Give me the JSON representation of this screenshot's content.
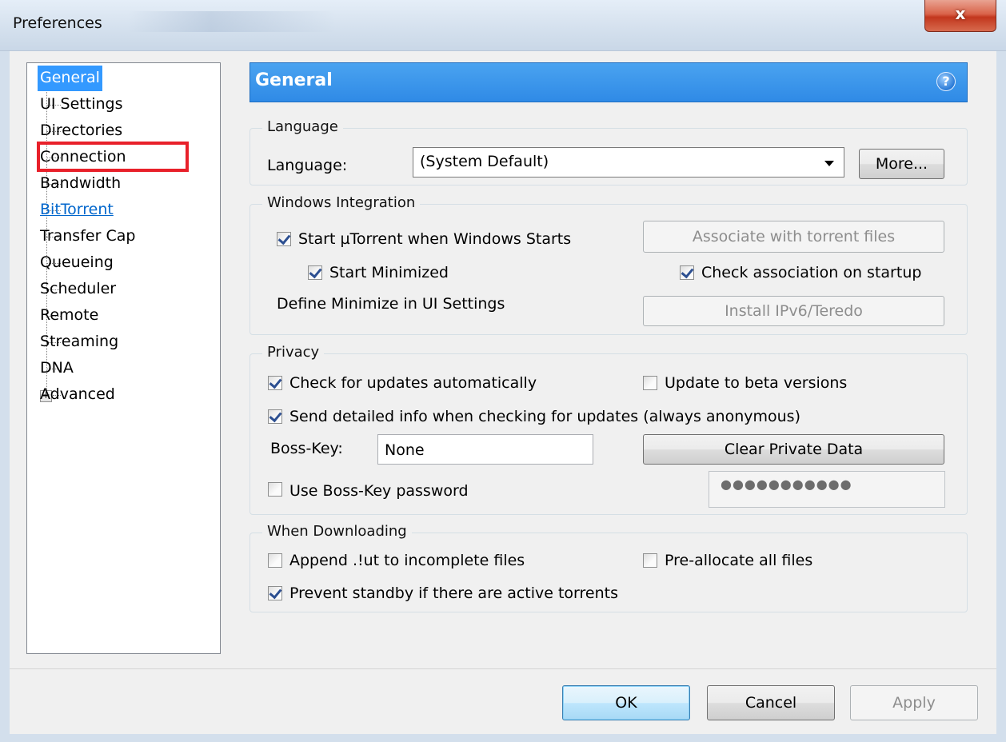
{
  "window": {
    "title": "Preferences",
    "close_glyph": "x"
  },
  "tree": {
    "items": [
      {
        "label": "General",
        "state": "selected"
      },
      {
        "label": "UI Settings"
      },
      {
        "label": "Directories"
      },
      {
        "label": "Connection"
      },
      {
        "label": "Bandwidth"
      },
      {
        "label": "BitTorrent",
        "state": "link"
      },
      {
        "label": "Transfer Cap"
      },
      {
        "label": "Queueing"
      },
      {
        "label": "Scheduler"
      },
      {
        "label": "Remote"
      },
      {
        "label": "Streaming"
      },
      {
        "label": "DNA"
      },
      {
        "label": "Advanced",
        "expandable": true
      }
    ],
    "expander_glyph": "+"
  },
  "header": {
    "title": "General",
    "help_glyph": "?"
  },
  "language": {
    "group_title": "Language",
    "label": "Language:",
    "selected": "(System Default)",
    "more_button": "More..."
  },
  "windows_integration": {
    "group_title": "Windows Integration",
    "start_with_windows": {
      "label": "Start µTorrent when Windows Starts",
      "checked": true
    },
    "start_minimized": {
      "label": "Start Minimized",
      "checked": true
    },
    "define_minimize": "Define Minimize in UI Settings",
    "associate_button": "Associate with torrent files",
    "check_association": {
      "label": "Check association on startup",
      "checked": true
    },
    "install_ipv6_button": "Install IPv6/Teredo"
  },
  "privacy": {
    "group_title": "Privacy",
    "check_updates": {
      "label": "Check for updates automatically",
      "checked": true
    },
    "beta_versions": {
      "label": "Update to beta versions",
      "checked": false
    },
    "send_info": {
      "label": "Send detailed info when checking for updates (always anonymous)",
      "checked": true
    },
    "boss_key_label": "Boss-Key:",
    "boss_key_value": "None",
    "clear_private_button": "Clear Private Data",
    "use_boss_password": {
      "label": "Use Boss-Key password",
      "checked": false
    },
    "password_mask": "●●●●●●●●●●●"
  },
  "downloading": {
    "group_title": "When Downloading",
    "append_ut": {
      "label": "Append .!ut to incomplete files",
      "checked": false
    },
    "preallocate": {
      "label": "Pre-allocate all files",
      "checked": false
    },
    "prevent_standby": {
      "label": "Prevent standby if there are active torrents",
      "checked": true
    }
  },
  "footer": {
    "ok": "OK",
    "cancel": "Cancel",
    "apply": "Apply"
  },
  "colors": {
    "selection": "#3399ff",
    "header_bg": "#2f8ae6",
    "highlight_box": "#e8202a",
    "link": "#0066cc"
  }
}
